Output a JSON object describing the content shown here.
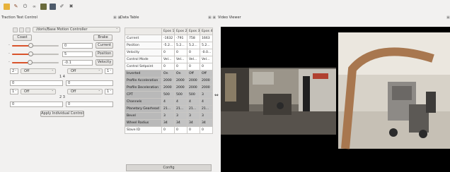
{
  "toolbar": {
    "icons": [
      "folder-icon",
      "wrench-icon",
      "power-icon",
      "chain-icon",
      "film-icon",
      "save-icon",
      "pencil-icon",
      "cross-icon"
    ]
  },
  "panels": {
    "traction": {
      "title": "Traction Test Control"
    },
    "data_table": {
      "title": "Data Table"
    },
    "video": {
      "title": "Video Viewer"
    }
  },
  "traction": {
    "topic_combo": "/doris/Base Motion Controller",
    "coast_label": "Coast",
    "brake_label": "Brake",
    "sliders": [
      {
        "value": "0",
        "button": "Current",
        "fill": 0.4
      },
      {
        "value": "5",
        "button": "Position",
        "fill": 0.4
      },
      {
        "value": "-0.1",
        "button": "Velocity",
        "fill": 0.38
      }
    ],
    "group1": {
      "index_left": "2",
      "mode_left": "Off",
      "mode_right": "Off",
      "index_right": "1",
      "center": "1 4",
      "value_left": "0",
      "value_right": "0"
    },
    "group2": {
      "index_left": "1",
      "mode_left": "Off",
      "mode_right": "Off",
      "index_right": "1",
      "center": "2 3",
      "value_left": "0",
      "value_right": "0"
    },
    "apply_label": "Apply Individual Control"
  },
  "table": {
    "headers": [
      "",
      "Epos 1",
      "Epos 2",
      "Epos 3",
      "Epos 4"
    ],
    "rows": [
      {
        "label": "Current",
        "values": [
          "-1632",
          "-791",
          "758",
          "1663"
        ],
        "sel": false
      },
      {
        "label": "Position",
        "values": [
          "-5.2...",
          "5.2...",
          "5.2...",
          "5.2..."
        ],
        "sel": false
      },
      {
        "label": "Velocity",
        "values": [
          "0",
          "0",
          "0",
          "-0.0..."
        ],
        "sel": false
      },
      {
        "label": "Control Mode",
        "values": [
          "Vel...",
          "Vel...",
          "Vel...",
          "Vel..."
        ],
        "sel": false
      },
      {
        "label": "Control Setpoint",
        "values": [
          "0",
          "0",
          "0",
          "0"
        ],
        "sel": false
      },
      {
        "label": "Inverted",
        "values": [
          "On",
          "On",
          "Off",
          "Off"
        ],
        "sel": true
      },
      {
        "label": "Profile Acceleration",
        "values": [
          "2000",
          "2000",
          "2000",
          "2000"
        ],
        "sel": true
      },
      {
        "label": "Profile Deceleration",
        "values": [
          "2000",
          "2000",
          "2000",
          "2000"
        ],
        "sel": true
      },
      {
        "label": "CPT",
        "values": [
          "500",
          "500",
          "500",
          "3"
        ],
        "sel": true
      },
      {
        "label": "Channels",
        "values": [
          "4",
          "4",
          "4",
          "4"
        ],
        "sel": true
      },
      {
        "label": "Planetary Gearhead",
        "values": [
          "21...",
          "21...",
          "21...",
          "21..."
        ],
        "sel": true
      },
      {
        "label": "Bevel",
        "values": [
          "3",
          "3",
          "3",
          "3"
        ],
        "sel": true
      },
      {
        "label": "Wheel Radius",
        "values": [
          "34",
          "34",
          "34",
          "34"
        ],
        "sel": true
      },
      {
        "label": "Slave ID",
        "values": [
          "0",
          "0",
          "0",
          "0"
        ],
        "sel": false
      }
    ],
    "config_label": "Config"
  },
  "colors": {
    "slider_accent": "#d9532b",
    "selected_row": "#c3c3c3"
  }
}
